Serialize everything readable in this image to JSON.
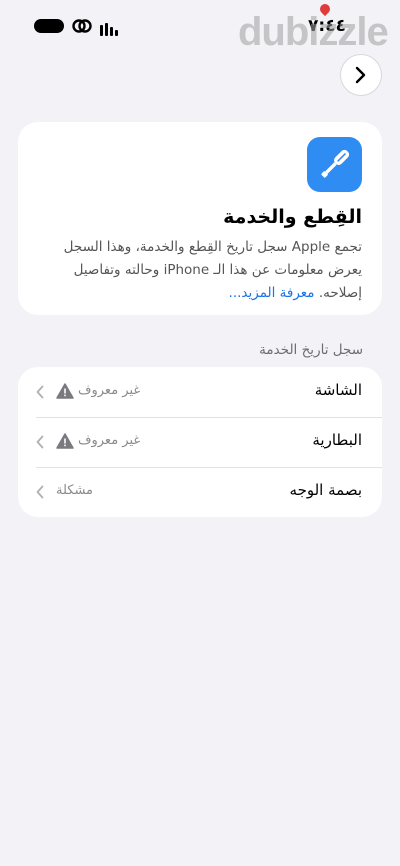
{
  "status_bar": {
    "time": "٧:٤٤",
    "watermark": "dubizzle"
  },
  "nav": {
    "forward_icon": "chevron-right-icon"
  },
  "info_card": {
    "icon": "screwdriver-icon",
    "icon_color": "#2f8cf3",
    "title": "القِطع والخدمة",
    "description": "تجمع Apple سجل تاريخ القِطع والخدمة، وهذا السجل يعرض معلومات عن هذا الـ iPhone وحالته وتفاصيل إصلاحه.",
    "learn_more": "معرفة المزيد..."
  },
  "service_history": {
    "section_label": "سجل تاريخ الخدمة",
    "rows": [
      {
        "label": "الشاشة",
        "value": "غير معروف",
        "warning": true
      },
      {
        "label": "البطارية",
        "value": "غير معروف",
        "warning": true
      },
      {
        "label": "بصمة الوجه",
        "value": "مشكلة",
        "warning": false
      }
    ]
  }
}
